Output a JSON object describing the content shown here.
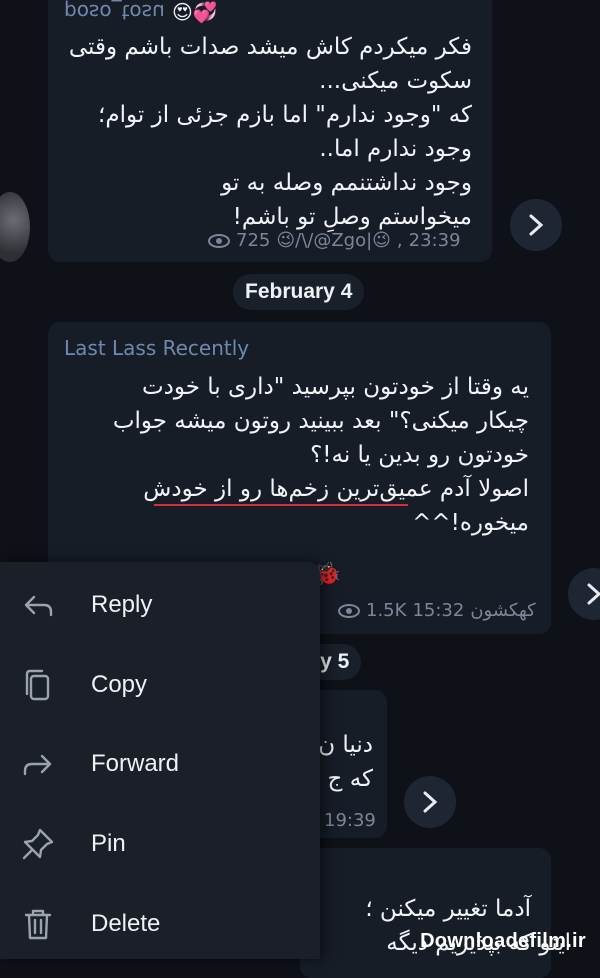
{
  "messages": [
    {
      "sender": "poso_tosu",
      "text": "فکر میکردم کاش میشد صدات باشم وقتی\nسکوت میکنی...\nکه \"وجود ندارم\" اما بازم جزئی از توام؛\nوجود ندارم اما..\nوجود نداشتنمم وصله به تو\nمیخواستم وصلِ تو باشم!",
      "views": "725",
      "signature": "😉/\\/@Zgo|😉",
      "time": "23:39"
    },
    {
      "sender": "Last Lass Recently",
      "text": "یه وقتا از خودتون بپرسید \"داری با خودت\nچیکار میکنی؟\" بعد ببینید روتون میشه جواب\nخودتون رو بدین یا نه!؟\nاصولا آدم عمیق‌ترین زخم‌ها رو از خودش\nمیخوره!^^",
      "reaction": "🐞",
      "views": "1.5K",
      "signature": "کهکشون",
      "time": "15:32"
    },
    {
      "text_line1": "دنیا ن",
      "text_line2": "که ج",
      "time": "19:39"
    },
    {
      "text_line1": "آدما تغییر میکنن ؛",
      "text_line2": "اینو که بپذیریم دیگه"
    }
  ],
  "dates": {
    "feb4": "February 4",
    "feb5_partial": "ry 5"
  },
  "context_menu": {
    "items": [
      {
        "label": "Reply",
        "icon": "reply-icon"
      },
      {
        "label": "Copy",
        "icon": "copy-icon"
      },
      {
        "label": "Forward",
        "icon": "forward-icon"
      },
      {
        "label": "Pin",
        "icon": "pin-icon"
      },
      {
        "label": "Delete",
        "icon": "trash-icon"
      }
    ]
  },
  "watermark": "Downloadefilm.ir",
  "colors": {
    "background": "#0e1117",
    "bubble": "#171d27",
    "menu": "#1a1f28",
    "sender_name": "#6f88ad",
    "underline": "#d0303a"
  }
}
